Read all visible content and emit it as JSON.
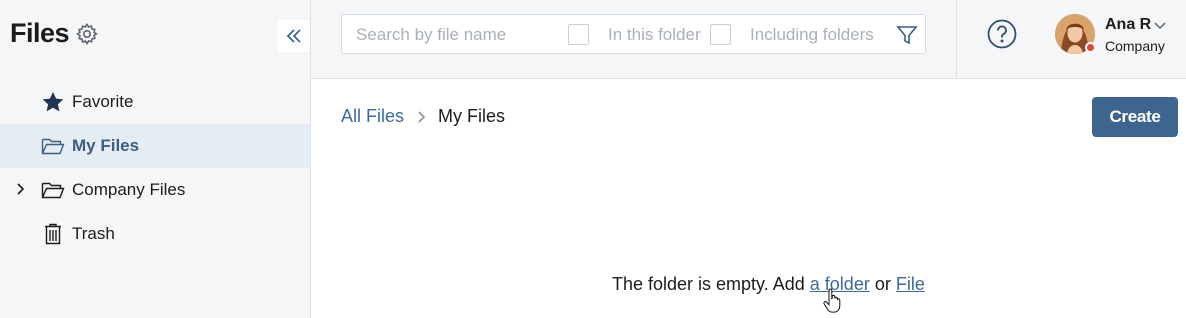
{
  "sidebar": {
    "title": "Files",
    "settings_icon": "gear-icon",
    "collapse_icon": "double-chevron-left-icon",
    "items": [
      {
        "label": "Favorite",
        "icon": "star-icon",
        "active": false
      },
      {
        "label": "My Files",
        "icon": "folder-open-icon",
        "active": true
      },
      {
        "label": "Company Files",
        "icon": "folder-open-icon",
        "active": false,
        "expandable": true
      },
      {
        "label": "Trash",
        "icon": "trash-icon",
        "active": false
      }
    ]
  },
  "topbar": {
    "search": {
      "placeholder": "Search by file name",
      "value": "",
      "option_in_folder": "In this folder",
      "option_including_folders": "Including folders"
    },
    "help_icon": "question-circle-icon",
    "user": {
      "name": "Ana R",
      "company": "Company",
      "status_color": "#e0443a"
    }
  },
  "main": {
    "breadcrumb": {
      "root": "All Files",
      "current": "My Files"
    },
    "create_label": "Create",
    "empty": {
      "text": "The folder is empty. Add",
      "folder_link": "a folder",
      "or": "or",
      "file_link": "File"
    }
  },
  "colors": {
    "accent": "#3d6590",
    "link": "#3d6a9a",
    "sidebar_bg": "#f4f6f8",
    "active_bg": "#e6ecf3"
  }
}
